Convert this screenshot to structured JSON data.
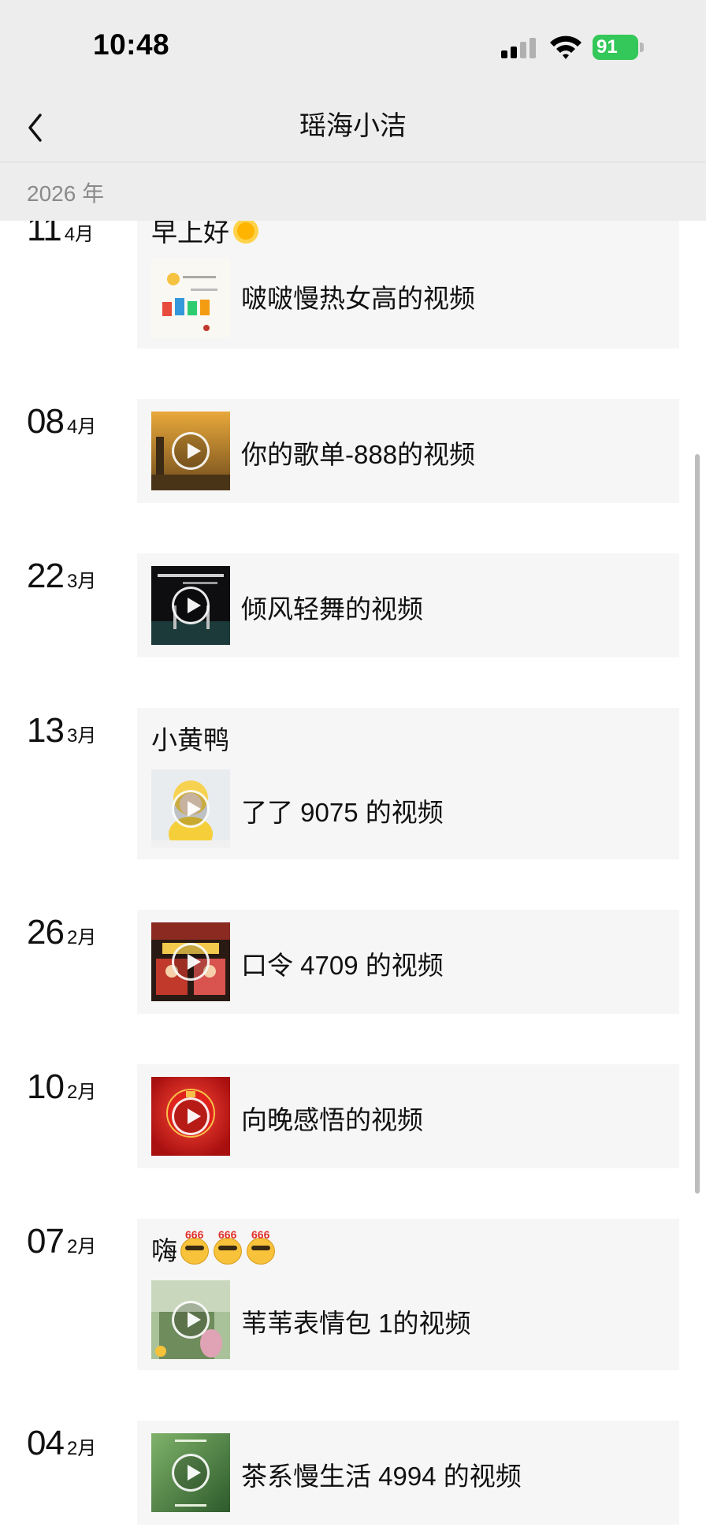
{
  "status_bar": {
    "time": "10:48",
    "battery_level": "91",
    "battery_color": "#34c759",
    "icons": [
      "cellular-signal-icon",
      "wifi-icon",
      "battery-charging-icon"
    ]
  },
  "nav": {
    "back_icon": "chevron-left-icon",
    "title": "瑶海小洁"
  },
  "year_header": "2026 年",
  "entries": [
    {
      "day": "11",
      "month": "4月",
      "caption": "早上好",
      "caption_emoji": "sun-emoji",
      "title": "啵啵慢热女高的视频",
      "thumb_color": "#f4f1e8"
    },
    {
      "day": "08",
      "month": "4月",
      "caption": "",
      "title": "你的歌单-888的视频",
      "thumb_color": "#b8862e"
    },
    {
      "day": "22",
      "month": "3月",
      "caption": "",
      "title": "倾风轻舞的视频",
      "thumb_color": "#111111"
    },
    {
      "day": "13",
      "month": "3月",
      "caption": "小黄鸭",
      "title": "了了 9075 的视频",
      "thumb_color": "#f3ecd2"
    },
    {
      "day": "26",
      "month": "2月",
      "caption": "",
      "title": "口令 4709 的视频",
      "thumb_color": "#c43b2a"
    },
    {
      "day": "10",
      "month": "2月",
      "caption": "",
      "title": "向晚感悟的视频",
      "thumb_color": "#cf1f1f"
    },
    {
      "day": "07",
      "month": "2月",
      "caption": "嗨",
      "caption_emoji": "emoji-666",
      "caption_emoji_text": "666",
      "title": "苇苇表情包 1的视频",
      "thumb_color": "#7d9a6b"
    },
    {
      "day": "04",
      "month": "2月",
      "caption": "",
      "title": "茶系慢生活 4994 的视频",
      "thumb_color": "#3c6b3a"
    }
  ]
}
